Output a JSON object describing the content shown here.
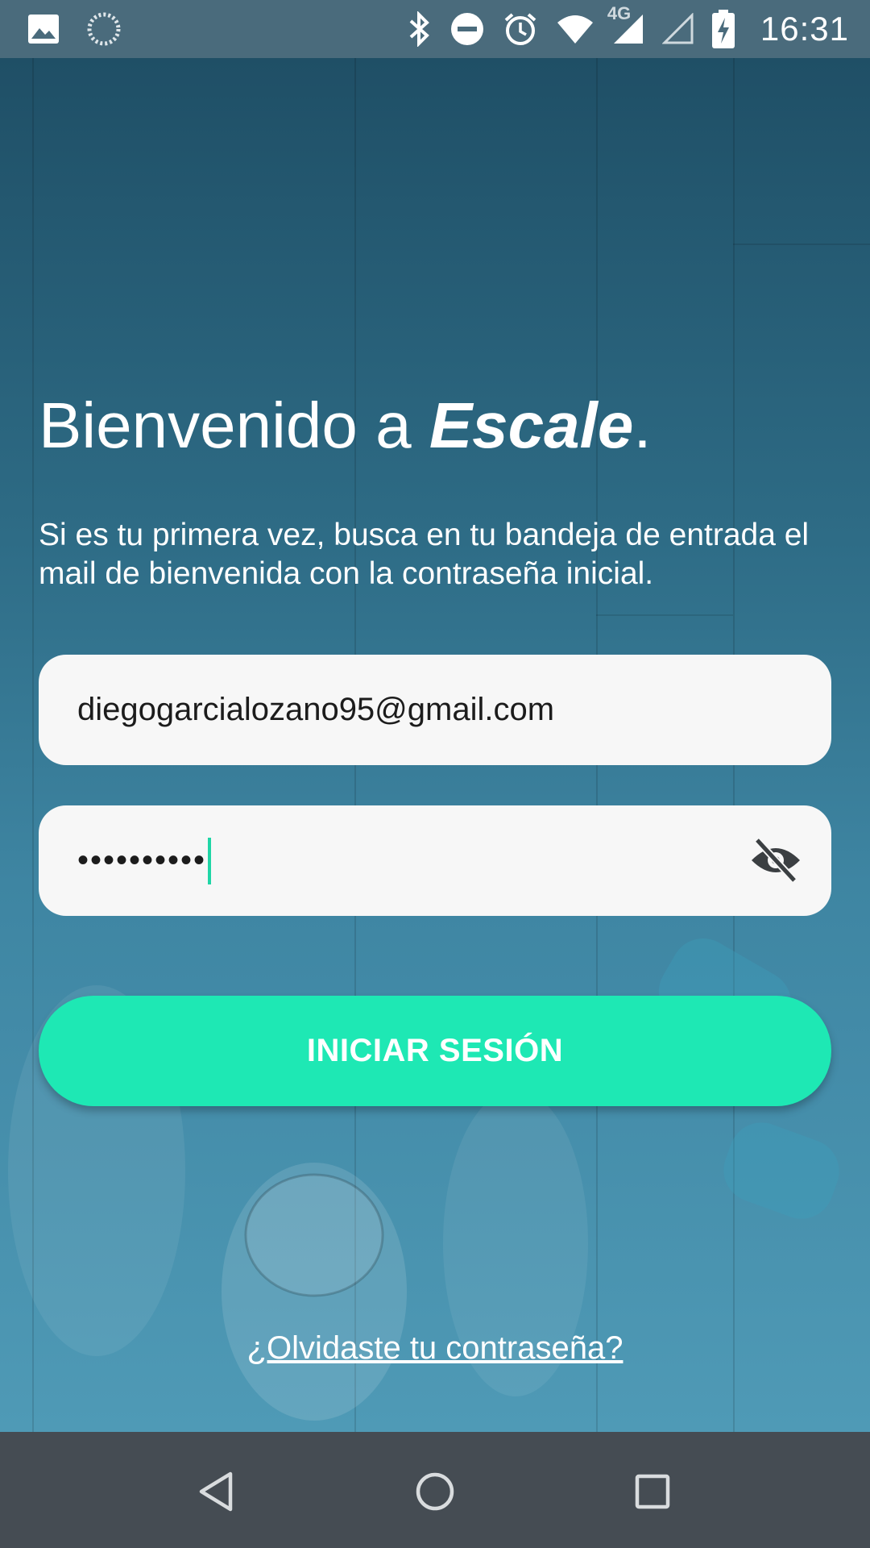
{
  "status_bar": {
    "time": "16:31",
    "network_label": "4G",
    "icons": [
      "gallery-icon",
      "sync-icon",
      "bluetooth-icon",
      "do-not-disturb-icon",
      "alarm-icon",
      "wifi-icon",
      "signal-icon",
      "signal-empty-icon",
      "battery-charging-icon"
    ]
  },
  "welcome": {
    "title_prefix": "Bienvenido a ",
    "brand": "Escale",
    "title_suffix": ".",
    "subtitle": "Si es tu primera vez, busca en tu bandeja de entrada el mail de bienvenida con la contraseña inicial."
  },
  "form": {
    "email_value": "diegogarcialozano95@gmail.com",
    "password_masked": "••••••••••",
    "login_label": "INICIAR SESIÓN",
    "forgot_label": "¿Olvidaste tu contraseña?"
  },
  "colors": {
    "accent": "#1ee8b4",
    "caret": "#1fd6a6",
    "field_bg": "#f7f7f7",
    "nav_bar": "#454c53",
    "status_bar": "#4a6b7c"
  },
  "nav_bar": {
    "icons": [
      "back-icon",
      "home-icon",
      "recents-icon"
    ]
  }
}
